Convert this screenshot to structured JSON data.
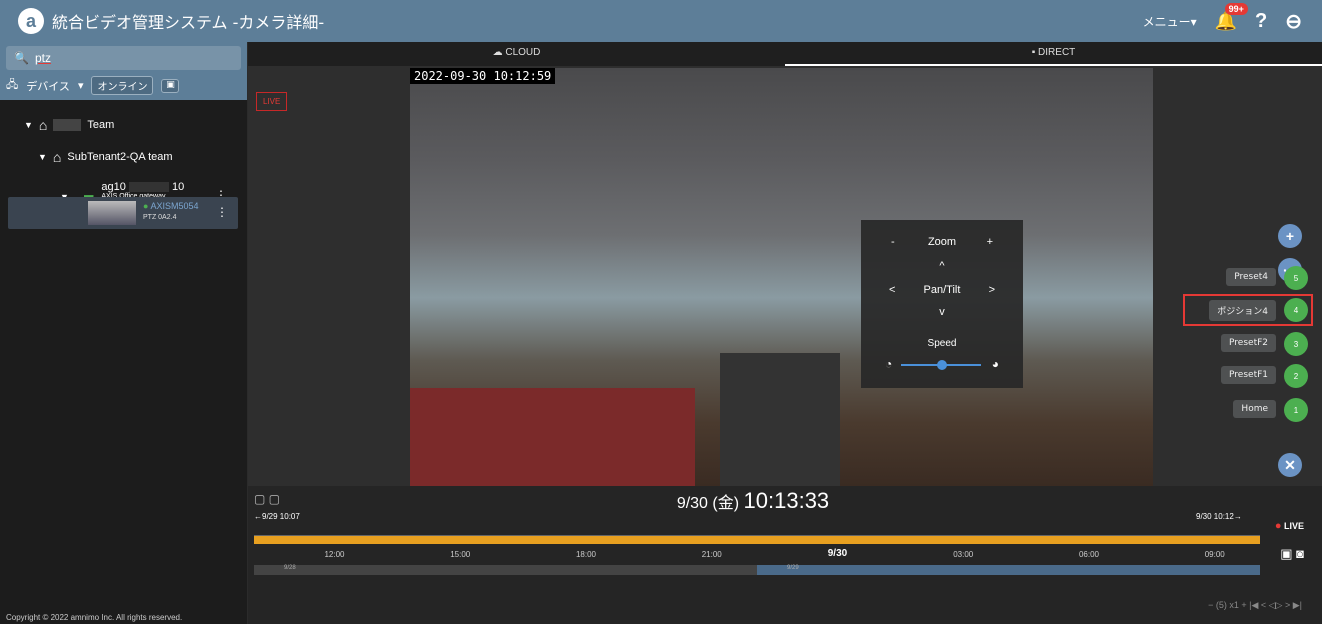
{
  "header": {
    "logo_char": "a",
    "title": "統合ビデオ管理システム -カメラ詳細-",
    "menu_label": "メニュー▾",
    "badge": "99+",
    "help": "?",
    "account": "⬤"
  },
  "sidebar": {
    "search_value": "ptz",
    "device_label": "デバイス",
    "online_label": "オンライン",
    "tree": {
      "team": "Team",
      "subtenant": "SubTenant2-QA team",
      "gateway_name": "ag10",
      "gateway_suffix": "10",
      "gateway_tags": "AXIS   Office gateway",
      "camera_name": "AXISM5054",
      "camera_tags": "PTZ   0A2.4"
    },
    "copyright": "Copyright © 2022 amnimo Inc. All rights reserved."
  },
  "tabs": [
    "CLOUD",
    "DIRECT"
  ],
  "video": {
    "live_tag": "LIVE",
    "timestamp": "2022-09-30 10:12:59"
  },
  "ptz": {
    "zoom": "Zoom",
    "zoom_minus": "-",
    "zoom_plus": "+",
    "up": "^",
    "pantilt": "Pan/Tilt",
    "left": "<",
    "right": ">",
    "down": "v",
    "speed": "Speed"
  },
  "presets": [
    {
      "label": "Preset4",
      "num": "5"
    },
    {
      "label": "ポジション4",
      "num": "4"
    },
    {
      "label": "PresetF2",
      "num": "3"
    },
    {
      "label": "PresetF1",
      "num": "2"
    },
    {
      "label": "Home",
      "num": "1"
    }
  ],
  "timeline": {
    "date": "9/30",
    "weekday": "(金)",
    "time": "10:13:33",
    "range_start": "9/29 10:07",
    "range_end": "9/30 10:12",
    "ticks": [
      "12:00",
      "15:00",
      "18:00",
      "21:00",
      "9/30",
      "03:00",
      "06:00",
      "09:00"
    ],
    "day_labels": [
      "9/28",
      "9/29"
    ],
    "live": "LIVE",
    "playback": "−  (5) x1  +     |◀   <   ◁▷   >   ▶|"
  },
  "colors": {
    "header": "#5d7e98",
    "timeline_bar": "#e8a020",
    "preset_num": "#4caf50",
    "highlight": "#e53935"
  }
}
